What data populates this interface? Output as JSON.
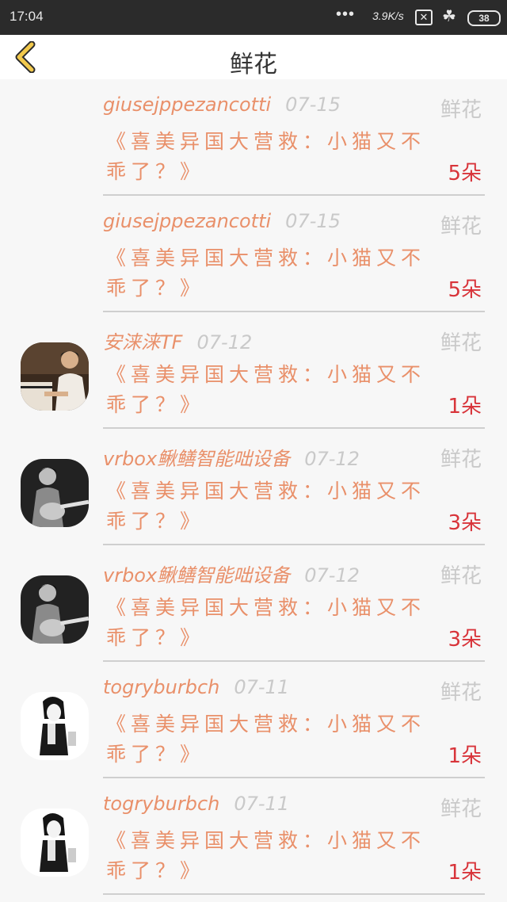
{
  "status_bar": {
    "time": "17:04",
    "dots": "•••",
    "speed": "3.9K/s",
    "battery": "38"
  },
  "header": {
    "title": "鲜花",
    "back_icon": "chevron-left-icon",
    "accent": "#f2c94c"
  },
  "items": [
    {
      "user": "giusejppezancotti",
      "date": "07-15",
      "type": "鲜花",
      "title": "《喜美异国大营救：小猫又不乖了？》",
      "count": "5朵",
      "avatar": "none"
    },
    {
      "user": "giusejppezancotti",
      "date": "07-15",
      "type": "鲜花",
      "title": "《喜美异国大营救：小猫又不乖了？》",
      "count": "5朵",
      "avatar": "none"
    },
    {
      "user": "安涞涞TF",
      "date": "07-12",
      "type": "鲜花",
      "title": "《喜美异国大营救：小猫又不乖了？》",
      "count": "1朵",
      "avatar": "piano-photo"
    },
    {
      "user": "vrbox鳅鳝智能咄设备",
      "date": "07-12",
      "type": "鲜花",
      "title": "《喜美异国大营救：小猫又不乖了？》",
      "count": "3朵",
      "avatar": "guitar-photo"
    },
    {
      "user": "vrbox鳅鳝智能咄设备",
      "date": "07-12",
      "type": "鲜花",
      "title": "《喜美异国大营救：小猫又不乖了？》",
      "count": "3朵",
      "avatar": "guitar-photo"
    },
    {
      "user": "togryburbch",
      "date": "07-11",
      "type": "鲜花",
      "title": "《喜美异国大营救：小猫又不乖了？》",
      "count": "1朵",
      "avatar": "girl-sketch"
    },
    {
      "user": "togryburbch",
      "date": "07-11",
      "type": "鲜花",
      "title": "《喜美异国大营救：小猫又不乖了？》",
      "count": "1朵",
      "avatar": "girl-sketch"
    }
  ]
}
